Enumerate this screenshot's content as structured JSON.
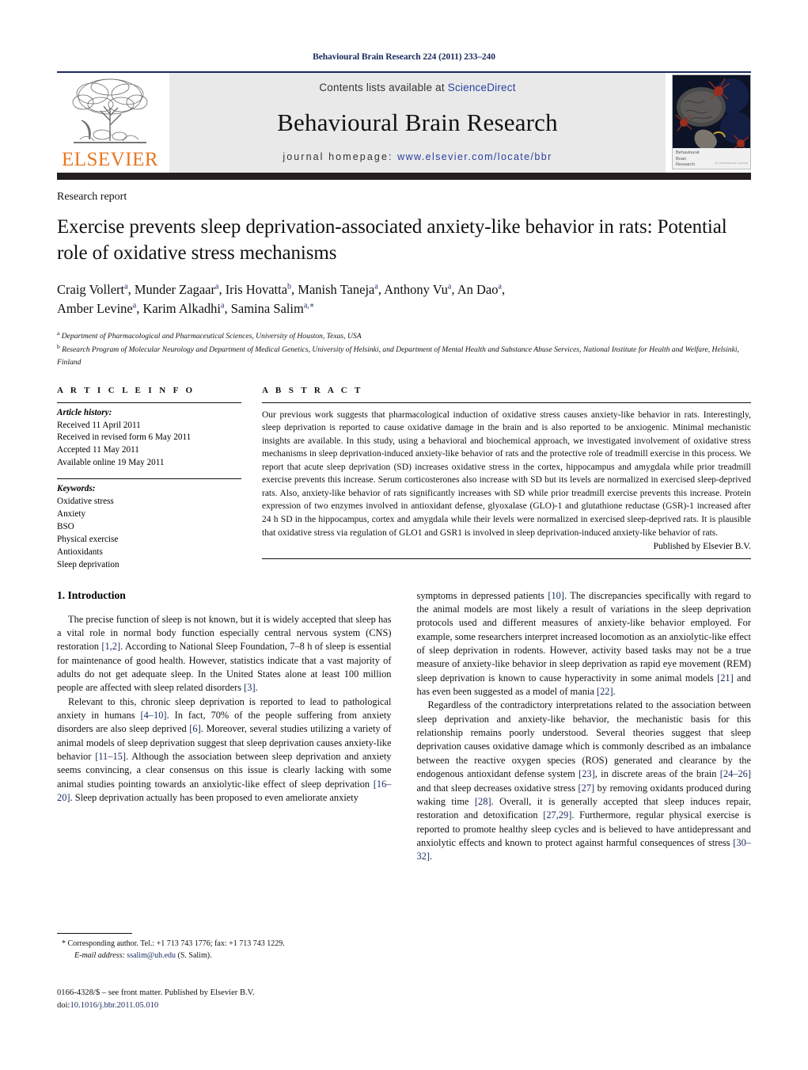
{
  "running_head": "Behavioural Brain Research 224 (2011) 233–240",
  "masthead": {
    "publisher_word": "ELSEVIER",
    "contents_prefix": "Contents lists available at ",
    "contents_link": "ScienceDirect",
    "journal_title": "Behavioural Brain Research",
    "homepage_prefix": "journal homepage: ",
    "homepage_url": "www.elsevier.com/locate/bbr",
    "cover_title_lines": [
      "Behavioural",
      "Brain",
      "Research"
    ],
    "cover_tiny": "an international journal"
  },
  "colors": {
    "navy": "#1a2a5e",
    "link_blue": "#2b3fa0",
    "elsevier_orange": "#E87722",
    "banner_grey": "#e9e9e9",
    "dark_bar": "#231f20"
  },
  "article": {
    "type": "Research report",
    "title": "Exercise prevents sleep deprivation-associated anxiety-like behavior in rats: Potential role of oxidative stress mechanisms",
    "authors_line1": "Craig Vollert a, Munder Zagaar a, Iris Hovatta b, Manish Taneja a, Anthony Vu a, An Dao a,",
    "authors_line2": "Amber Levine a, Karim Alkadhi a, Samina Salim a,*",
    "affiliation_a": "Department of Pharmacological and Pharmaceutical Sciences, University of Houston, Texas, USA",
    "affiliation_b": "Research Program of Molecular Neurology and Department of Medical Genetics, University of Helsinki, and Department of Mental Health and Substance Abuse Services, National Institute for Health and Welfare, Helsinki, Finland"
  },
  "article_info": {
    "heading": "A R T I C L E   I N F O",
    "history_label": "Article history:",
    "history": [
      "Received 11 April 2011",
      "Received in revised form 6 May 2011",
      "Accepted 11 May 2011",
      "Available online 19 May 2011"
    ],
    "keywords_label": "Keywords:",
    "keywords": [
      "Oxidative stress",
      "Anxiety",
      "BSO",
      "Physical exercise",
      "Antioxidants",
      "Sleep deprivation"
    ]
  },
  "abstract": {
    "heading": "A B S T R A C T",
    "text": "Our previous work suggests that pharmacological induction of oxidative stress causes anxiety-like behavior in rats. Interestingly, sleep deprivation is reported to cause oxidative damage in the brain and is also reported to be anxiogenic. Minimal mechanistic insights are available. In this study, using a behavioral and biochemical approach, we investigated involvement of oxidative stress mechanisms in sleep deprivation-induced anxiety-like behavior of rats and the protective role of treadmill exercise in this process. We report that acute sleep deprivation (SD) increases oxidative stress in the cortex, hippocampus and amygdala while prior treadmill exercise prevents this increase. Serum corticosterones also increase with SD but its levels are normalized in exercised sleep-deprived rats. Also, anxiety-like behavior of rats significantly increases with SD while prior treadmill exercise prevents this increase. Protein expression of two enzymes involved in antioxidant defense, glyoxalase (GLO)-1 and glutathione reductase (GSR)-1 increased after 24 h SD in the hippocampus, cortex and amygdala while their levels were normalized in exercised sleep-deprived rats. It is plausible that oxidative stress via regulation of GLO1 and GSR1 is involved in sleep deprivation-induced anxiety-like behavior of rats.",
    "publisher_note": "Published by Elsevier B.V."
  },
  "body": {
    "section_number_title": "1.  Introduction",
    "left_paragraphs": [
      "The precise function of sleep is not known, but it is widely accepted that sleep has a vital role in normal body function especially central nervous system (CNS) restoration [1,2]. According to National Sleep Foundation, 7–8 h of sleep is essential for maintenance of good health. However, statistics indicate that a vast majority of adults do not get adequate sleep. In the United States alone at least 100 million people are affected with sleep related disorders [3].",
      "Relevant to this, chronic sleep deprivation is reported to lead to pathological anxiety in humans [4–10]. In fact, 70% of the people suffering from anxiety disorders are also sleep deprived [6]. Moreover, several studies utilizing a variety of animal models of sleep deprivation suggest that sleep deprivation causes anxiety-like behavior [11–15]. Although the association between sleep deprivation and anxiety seems convincing, a clear consensus on this issue is clearly lacking with some animal studies pointing towards an anxiolytic-like effect of sleep deprivation [16–20]. Sleep deprivation actually has been proposed to even ameliorate anxiety"
    ],
    "right_paragraphs": [
      "symptoms in depressed patients [10]. The discrepancies specifically with regard to the animal models are most likely a result of variations in the sleep deprivation protocols used and different measures of anxiety-like behavior employed. For example, some researchers interpret increased locomotion as an anxiolytic-like effect of sleep deprivation in rodents. However, activity based tasks may not be a true measure of anxiety-like behavior in sleep deprivation as rapid eye movement (REM) sleep deprivation is known to cause hyperactivity in some animal models [21] and has even been suggested as a model of mania [22].",
      "Regardless of the contradictory interpretations related to the association between sleep deprivation and anxiety-like behavior, the mechanistic basis for this relationship remains poorly understood. Several theories suggest that sleep deprivation causes oxidative damage which is commonly described as an imbalance between the reactive oxygen species (ROS) generated and clearance by the endogenous antioxidant defense system [23], in discrete areas of the brain [24–26] and that sleep decreases oxidative stress [27] by removing oxidants produced during waking time [28]. Overall, it is generally accepted that sleep induces repair, restoration and detoxification [27,29]. Furthermore, regular physical exercise is reported to promote healthy sleep cycles and is believed to have antidepressant and anxiolytic effects and known to protect against harmful consequences of stress [30–32]."
    ]
  },
  "footnote": {
    "corresponding": "* Corresponding author. Tel.: +1 713 743 1776; fax: +1 713 743 1229.",
    "email_label": "E-mail address:",
    "email": "ssalim@uh.edu",
    "email_suffix": "(S. Salim).",
    "imprint": "0166-4328/$ – see front matter. Published by Elsevier B.V.",
    "doi_label": "doi:",
    "doi": "10.1016/j.bbr.2011.05.010"
  }
}
